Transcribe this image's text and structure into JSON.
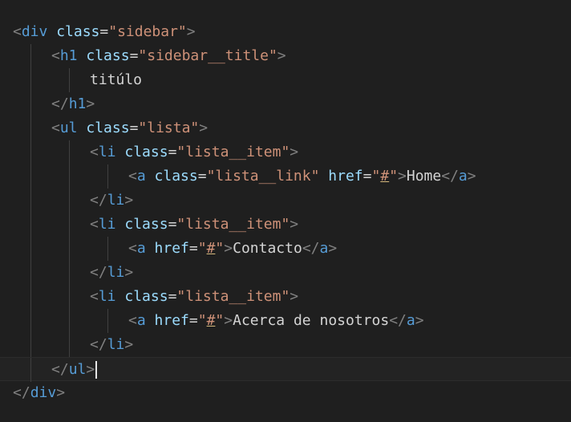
{
  "editor": {
    "lines": [
      {
        "indent": 0,
        "tokens": [
          {
            "t": "<",
            "c": "punc"
          },
          {
            "t": "div",
            "c": "tag"
          },
          {
            "t": " ",
            "c": "text"
          },
          {
            "t": "class",
            "c": "attr"
          },
          {
            "t": "=",
            "c": "text"
          },
          {
            "t": "\"sidebar\"",
            "c": "str"
          },
          {
            "t": ">",
            "c": "punc"
          }
        ]
      },
      {
        "indent": 1,
        "tokens": [
          {
            "t": "<",
            "c": "punc"
          },
          {
            "t": "h1",
            "c": "tag"
          },
          {
            "t": " ",
            "c": "text"
          },
          {
            "t": "class",
            "c": "attr"
          },
          {
            "t": "=",
            "c": "text"
          },
          {
            "t": "\"sidebar__title\"",
            "c": "str"
          },
          {
            "t": ">",
            "c": "punc"
          }
        ]
      },
      {
        "indent": 2,
        "tokens": [
          {
            "t": "titúlo",
            "c": "text"
          }
        ]
      },
      {
        "indent": 1,
        "tokens": [
          {
            "t": "</",
            "c": "punc"
          },
          {
            "t": "h1",
            "c": "tag"
          },
          {
            "t": ">",
            "c": "punc"
          }
        ]
      },
      {
        "indent": 1,
        "tokens": [
          {
            "t": "<",
            "c": "punc"
          },
          {
            "t": "ul",
            "c": "tag"
          },
          {
            "t": " ",
            "c": "text"
          },
          {
            "t": "class",
            "c": "attr"
          },
          {
            "t": "=",
            "c": "text"
          },
          {
            "t": "\"lista\"",
            "c": "str"
          },
          {
            "t": ">",
            "c": "punc"
          }
        ]
      },
      {
        "indent": 2,
        "tokens": [
          {
            "t": "<",
            "c": "punc"
          },
          {
            "t": "li",
            "c": "tag"
          },
          {
            "t": " ",
            "c": "text"
          },
          {
            "t": "class",
            "c": "attr"
          },
          {
            "t": "=",
            "c": "text"
          },
          {
            "t": "\"lista__item\"",
            "c": "str"
          },
          {
            "t": ">",
            "c": "punc"
          }
        ]
      },
      {
        "indent": 3,
        "tokens": [
          {
            "t": "<",
            "c": "punc"
          },
          {
            "t": "a",
            "c": "tag"
          },
          {
            "t": " ",
            "c": "text"
          },
          {
            "t": "class",
            "c": "attr"
          },
          {
            "t": "=",
            "c": "text"
          },
          {
            "t": "\"lista__link\"",
            "c": "str"
          },
          {
            "t": " ",
            "c": "text"
          },
          {
            "t": "href",
            "c": "attr"
          },
          {
            "t": "=",
            "c": "text"
          },
          {
            "t": "\"",
            "c": "str"
          },
          {
            "t": "#",
            "c": "warn"
          },
          {
            "t": "\"",
            "c": "str"
          },
          {
            "t": ">",
            "c": "punc"
          },
          {
            "t": "Home",
            "c": "text"
          },
          {
            "t": "</",
            "c": "punc"
          },
          {
            "t": "a",
            "c": "tag"
          },
          {
            "t": ">",
            "c": "punc"
          }
        ]
      },
      {
        "indent": 2,
        "tokens": [
          {
            "t": "</",
            "c": "punc"
          },
          {
            "t": "li",
            "c": "tag"
          },
          {
            "t": ">",
            "c": "punc"
          }
        ]
      },
      {
        "indent": 2,
        "tokens": [
          {
            "t": "<",
            "c": "punc"
          },
          {
            "t": "li",
            "c": "tag"
          },
          {
            "t": " ",
            "c": "text"
          },
          {
            "t": "class",
            "c": "attr"
          },
          {
            "t": "=",
            "c": "text"
          },
          {
            "t": "\"lista__item\"",
            "c": "str"
          },
          {
            "t": ">",
            "c": "punc"
          }
        ]
      },
      {
        "indent": 3,
        "tokens": [
          {
            "t": "<",
            "c": "punc"
          },
          {
            "t": "a",
            "c": "tag"
          },
          {
            "t": " ",
            "c": "text"
          },
          {
            "t": "href",
            "c": "attr"
          },
          {
            "t": "=",
            "c": "text"
          },
          {
            "t": "\"",
            "c": "str"
          },
          {
            "t": "#",
            "c": "warn"
          },
          {
            "t": "\"",
            "c": "str"
          },
          {
            "t": ">",
            "c": "punc"
          },
          {
            "t": "Contacto",
            "c": "text"
          },
          {
            "t": "</",
            "c": "punc"
          },
          {
            "t": "a",
            "c": "tag"
          },
          {
            "t": ">",
            "c": "punc"
          }
        ]
      },
      {
        "indent": 2,
        "tokens": [
          {
            "t": "</",
            "c": "punc"
          },
          {
            "t": "li",
            "c": "tag"
          },
          {
            "t": ">",
            "c": "punc"
          }
        ]
      },
      {
        "indent": 2,
        "tokens": [
          {
            "t": "<",
            "c": "punc"
          },
          {
            "t": "li",
            "c": "tag"
          },
          {
            "t": " ",
            "c": "text"
          },
          {
            "t": "class",
            "c": "attr"
          },
          {
            "t": "=",
            "c": "text"
          },
          {
            "t": "\"lista__item\"",
            "c": "str"
          },
          {
            "t": ">",
            "c": "punc"
          }
        ]
      },
      {
        "indent": 3,
        "tokens": [
          {
            "t": "<",
            "c": "punc"
          },
          {
            "t": "a",
            "c": "tag"
          },
          {
            "t": " ",
            "c": "text"
          },
          {
            "t": "href",
            "c": "attr"
          },
          {
            "t": "=",
            "c": "text"
          },
          {
            "t": "\"",
            "c": "str"
          },
          {
            "t": "#",
            "c": "warn"
          },
          {
            "t": "\"",
            "c": "str"
          },
          {
            "t": ">",
            "c": "punc"
          },
          {
            "t": "Acerca de nosotros",
            "c": "text"
          },
          {
            "t": "</",
            "c": "punc"
          },
          {
            "t": "a",
            "c": "tag"
          },
          {
            "t": ">",
            "c": "punc"
          }
        ]
      },
      {
        "indent": 2,
        "tokens": [
          {
            "t": "</",
            "c": "punc"
          },
          {
            "t": "li",
            "c": "tag"
          },
          {
            "t": ">",
            "c": "punc"
          }
        ]
      },
      {
        "indent": 1,
        "current": true,
        "cursor": true,
        "tokens": [
          {
            "t": "</",
            "c": "punc"
          },
          {
            "t": "ul",
            "c": "tag"
          },
          {
            "t": ">",
            "c": "punc"
          }
        ]
      },
      {
        "indent": 0,
        "tokens": [
          {
            "t": "</",
            "c": "punc"
          },
          {
            "t": "div",
            "c": "tag"
          },
          {
            "t": ">",
            "c": "punc"
          }
        ]
      }
    ]
  },
  "colors": {
    "background": "#1f1f1f",
    "tag": "#569cd6",
    "attribute": "#9cdcfe",
    "string": "#ce9178",
    "punctuation": "#808080",
    "text": "#d4d4d4"
  }
}
